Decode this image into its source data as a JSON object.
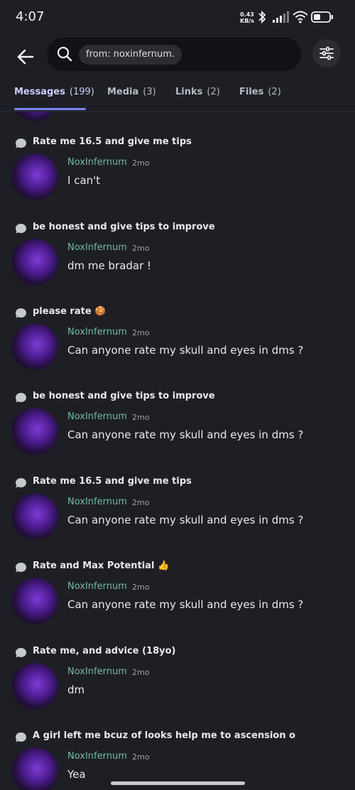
{
  "status_bar": {
    "time": "4:07",
    "speed_value": "0.43",
    "speed_unit": "KB/s",
    "icons": [
      "bluetooth-icon",
      "signal-icon",
      "wifi-icon",
      "battery-icon"
    ]
  },
  "search": {
    "query_chip": "from: noxinfernum."
  },
  "tabs": [
    {
      "label": "Messages",
      "count": "(199)",
      "active": true
    },
    {
      "label": "Media",
      "count": "(3)",
      "active": false
    },
    {
      "label": "Links",
      "count": "(2)",
      "active": false
    },
    {
      "label": "Files",
      "count": "(2)",
      "active": false
    }
  ],
  "results": [
    {
      "channel": "Rate me 16.5 and give me tips",
      "author": "NoxInfernum",
      "time": "2mo",
      "message": "I can't"
    },
    {
      "channel": "be honest and give tips to improve",
      "author": "NoxInfernum",
      "time": "2mo",
      "message": "dm me bradar !"
    },
    {
      "channel": "please rate 🍪",
      "author": "NoxInfernum",
      "time": "2mo",
      "message": "Can anyone rate my skull and eyes in dms ?"
    },
    {
      "channel": "be honest and give tips to improve",
      "author": "NoxInfernum",
      "time": "2mo",
      "message": "Can anyone rate my skull and eyes in dms ?"
    },
    {
      "channel": "Rate me 16.5 and give me tips",
      "author": "NoxInfernum",
      "time": "2mo",
      "message": "Can anyone rate my skull and eyes in dms ?"
    },
    {
      "channel": "Rate and Max Potential 👍",
      "author": "NoxInfernum",
      "time": "2mo",
      "message": "Can anyone rate my skull and eyes in dms ?"
    },
    {
      "channel": "Rate me, and advice (18yo)",
      "author": "NoxInfernum",
      "time": "2mo",
      "message": "dm"
    },
    {
      "channel": "A girl left me bcuz of looks help me to ascension o",
      "author": "NoxInfernum",
      "time": "2mo",
      "message": "Yea"
    }
  ],
  "colors": {
    "background": "#1e1f25",
    "accent": "#7b84f3",
    "author": "#74b9a2"
  }
}
